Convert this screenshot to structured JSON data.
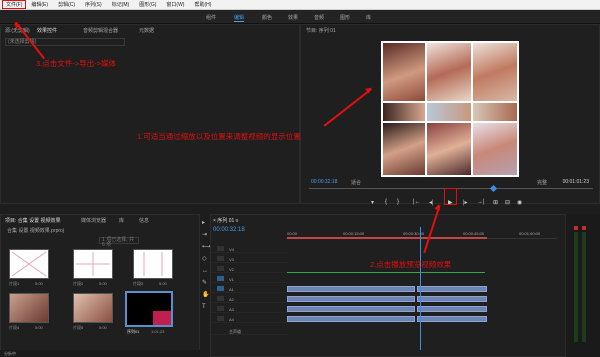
{
  "menubar": {
    "items": [
      "文件(F)",
      "编辑(E)",
      "剪辑(C)",
      "序列(S)",
      "标记(M)",
      "图形(G)",
      "窗口(W)",
      "帮助(H)"
    ],
    "highlight_color": "#e01010"
  },
  "workspaces": [
    "组件",
    "编辑",
    "颜色",
    "效果",
    "音频",
    "图形",
    "库"
  ],
  "source_panel": {
    "tabs": [
      "源:(无剪辑)",
      "效果控件",
      "音频剪辑混合器",
      "元数据"
    ],
    "field": "(未选择剪辑)"
  },
  "program": {
    "title": "节目: 序列 01",
    "timecode_left": "00:00:32:18",
    "fit": "适合",
    "full": "完整",
    "timecode_right": "00:01:01:23",
    "transport": [
      "▾",
      "{",
      "}",
      "|←",
      "◂|",
      "▶",
      "|▸",
      "→|",
      "⊞",
      "⊟",
      "◉"
    ]
  },
  "project_panel": {
    "tabs": [
      "项目: 合集 设置 视频效果",
      "媒体浏览器",
      "库",
      "信息"
    ],
    "project_name": "合集 设置 视频效果.prproj",
    "search_placeholder": "1 项已选择, 共 6 项",
    "items": [
      "片段1",
      "片段2",
      "片段3",
      "片段4",
      "片段5",
      "序列01"
    ],
    "durations": [
      "5:00",
      "5:00",
      "5:00",
      "5:00",
      "5:00",
      "1:01:23"
    ]
  },
  "status": {
    "text": "分析中"
  },
  "timeline": {
    "title": "× 序列 01 ≡",
    "timecode": "00:00:32:18",
    "ruler": [
      "00:00",
      "00:00:15:00",
      "00:00:30:00",
      "00:00:45:00",
      "00:01:00:00"
    ],
    "tracks": [
      "V4",
      "V3",
      "V2",
      "V1",
      "A1",
      "A2",
      "A3",
      "A4",
      "主声道"
    ],
    "clip_color": "#6d85b5",
    "playhead_color": "#3c8fe0"
  },
  "annotations": {
    "step3": "3.点击文件->导出->媒体",
    "step1": "1.可适当通过缩放以及位置来调整视频的显示位置",
    "step2": "2.点击播放预览视频效果",
    "color": "#e01010"
  }
}
